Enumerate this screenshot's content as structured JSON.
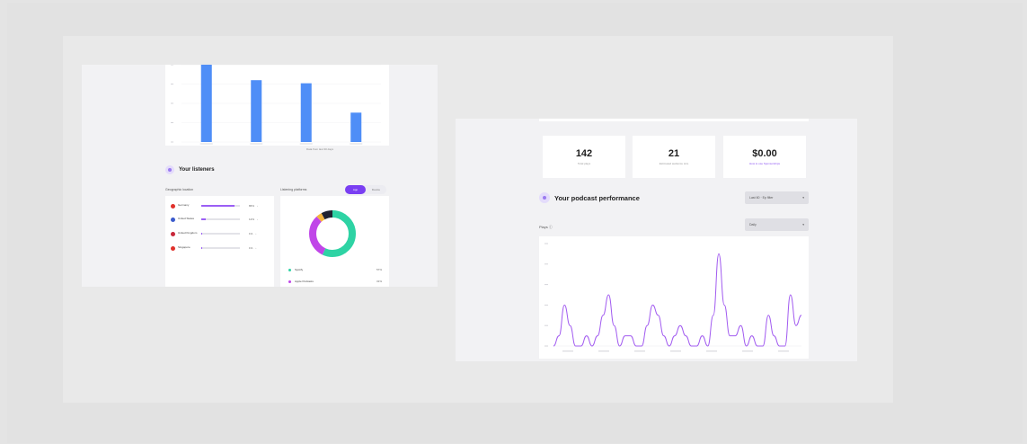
{
  "left_panel": {
    "caption": "Data from last 30 days",
    "listeners_title": "Your listeners",
    "geo_label": "Geographic location",
    "platforms_label": "Listening platforms",
    "toggle": [
      "App",
      "Device"
    ],
    "geo_rows": [
      {
        "name": "Germany",
        "pct": "86%",
        "fill": 0.86,
        "color": "#e0312b"
      },
      {
        "name": "United States",
        "pct": "12%",
        "fill": 0.12,
        "color": "#3b5bcc"
      },
      {
        "name": "United Kingdom",
        "pct": "1%",
        "fill": 0.01,
        "color": "#c8273a"
      },
      {
        "name": "Singapore",
        "pct": "1%",
        "fill": 0.01,
        "color": "#e0312b"
      }
    ],
    "donut": [
      {
        "name": "Spotify",
        "value": 57,
        "color": "#2ed3a4"
      },
      {
        "name": "Apple Podcasts",
        "value": 31,
        "color": "#c046e8"
      },
      {
        "name": "Other",
        "value": 4,
        "color": "#f4b43c"
      },
      {
        "name": "Rest",
        "value": 8,
        "color": "#1f2230"
      }
    ],
    "legend": [
      {
        "name": "Spotify",
        "pct": "57%",
        "color": "#2ed3a4"
      },
      {
        "name": "Apple Podcasts",
        "pct": "31%",
        "color": "#c046e8"
      }
    ]
  },
  "bar_chart": {
    "type": "bar",
    "categories": [
      "",
      "",
      "",
      ""
    ],
    "values": [
      100,
      80,
      76,
      38
    ],
    "ylim": [
      0,
      100
    ],
    "color": "#4f8ef7"
  },
  "right_panel": {
    "stats": [
      {
        "value": "142",
        "label": "Total plays",
        "link": false
      },
      {
        "value": "21",
        "label": "Estimated audience size",
        "link": false
      },
      {
        "value": "$0.00",
        "label": "How to use Sponsorships",
        "link": true
      }
    ],
    "performance_title": "Your podcast performance",
    "range_select": "Last 60 · Ep filter",
    "interval_select": "Daily",
    "plays_label": "Plays"
  },
  "chart_data": {
    "type": "line",
    "series": [
      {
        "values": [
          0,
          1,
          4,
          2,
          0,
          0,
          1,
          0,
          1,
          3,
          5,
          2,
          0,
          1,
          1,
          0,
          0,
          2,
          4,
          3,
          1,
          0,
          1,
          2,
          1,
          0,
          0,
          1,
          0,
          3,
          9,
          4,
          1,
          1,
          2,
          0,
          1,
          0,
          0,
          3,
          1,
          0,
          0,
          5,
          2,
          3
        ]
      }
    ],
    "ylim": [
      0,
      10
    ],
    "color": "#a25cf0"
  }
}
